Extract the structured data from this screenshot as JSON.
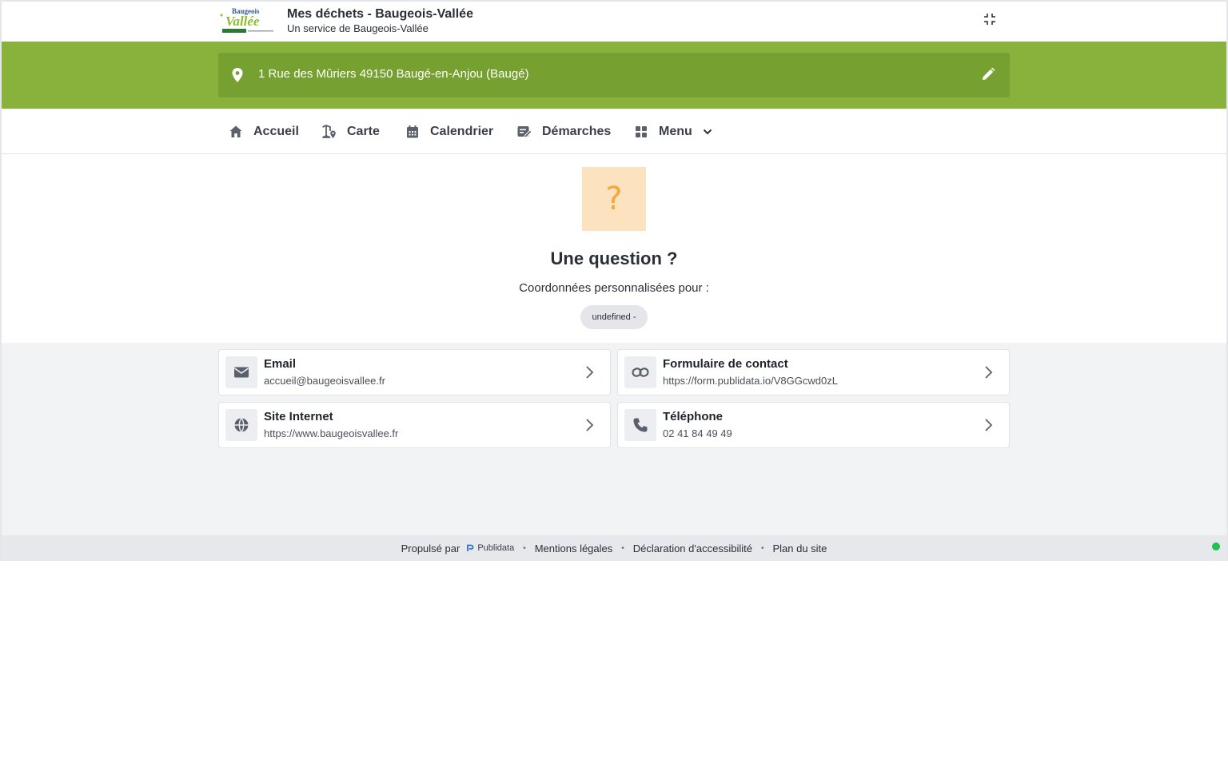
{
  "header": {
    "logo_text_top": "Baugeois",
    "logo_text_main": "Vallée",
    "title": "Mes déchets - Baugeois-Vallée",
    "subtitle": "Un service de Baugeois-Vallée",
    "collapse_icon": "collapse-icon"
  },
  "address": {
    "text": "1 Rue des Mûriers 49150 Baugé-en-Anjou (Baugé)",
    "icon": "map-pin-icon",
    "edit_icon": "pencil-icon"
  },
  "nav": {
    "items": [
      {
        "label": "Accueil",
        "icon": "home-icon"
      },
      {
        "label": "Carte",
        "icon": "map-icon"
      },
      {
        "label": "Calendrier",
        "icon": "calendar-icon"
      },
      {
        "label": "Démarches",
        "icon": "form-edit-icon"
      },
      {
        "label": "Menu",
        "icon": "grid-icon"
      }
    ]
  },
  "hero": {
    "icon_glyph": "?",
    "title": "Une question ?",
    "subtitle": "Coordonnées personnalisées pour :",
    "pill": "undefined -"
  },
  "contacts": [
    {
      "title": "Email",
      "value": "accueil@baugeoisvallee.fr",
      "icon": "envelope-icon"
    },
    {
      "title": "Formulaire de contact",
      "value": "https://form.publidata.io/V8GGcwd0zL",
      "icon": "link-icon"
    },
    {
      "title": "Site Internet",
      "value": "https://www.baugeoisvallee.fr",
      "icon": "globe-icon"
    },
    {
      "title": "Téléphone",
      "value": "02 41 84 49 49",
      "icon": "phone-icon"
    }
  ],
  "footer": {
    "powered_by": "Propulsé par",
    "brand": "Publidata",
    "sep": "•",
    "links": [
      "Mentions légales",
      "Déclaration d'accessibilité",
      "Plan du site"
    ]
  },
  "colors": {
    "brand_green": "#88b23c",
    "address_box": "#76a030",
    "hero_bg": "#fde2bf",
    "hero_glyph": "#f5a83a",
    "status_dot": "#1fc24f"
  }
}
